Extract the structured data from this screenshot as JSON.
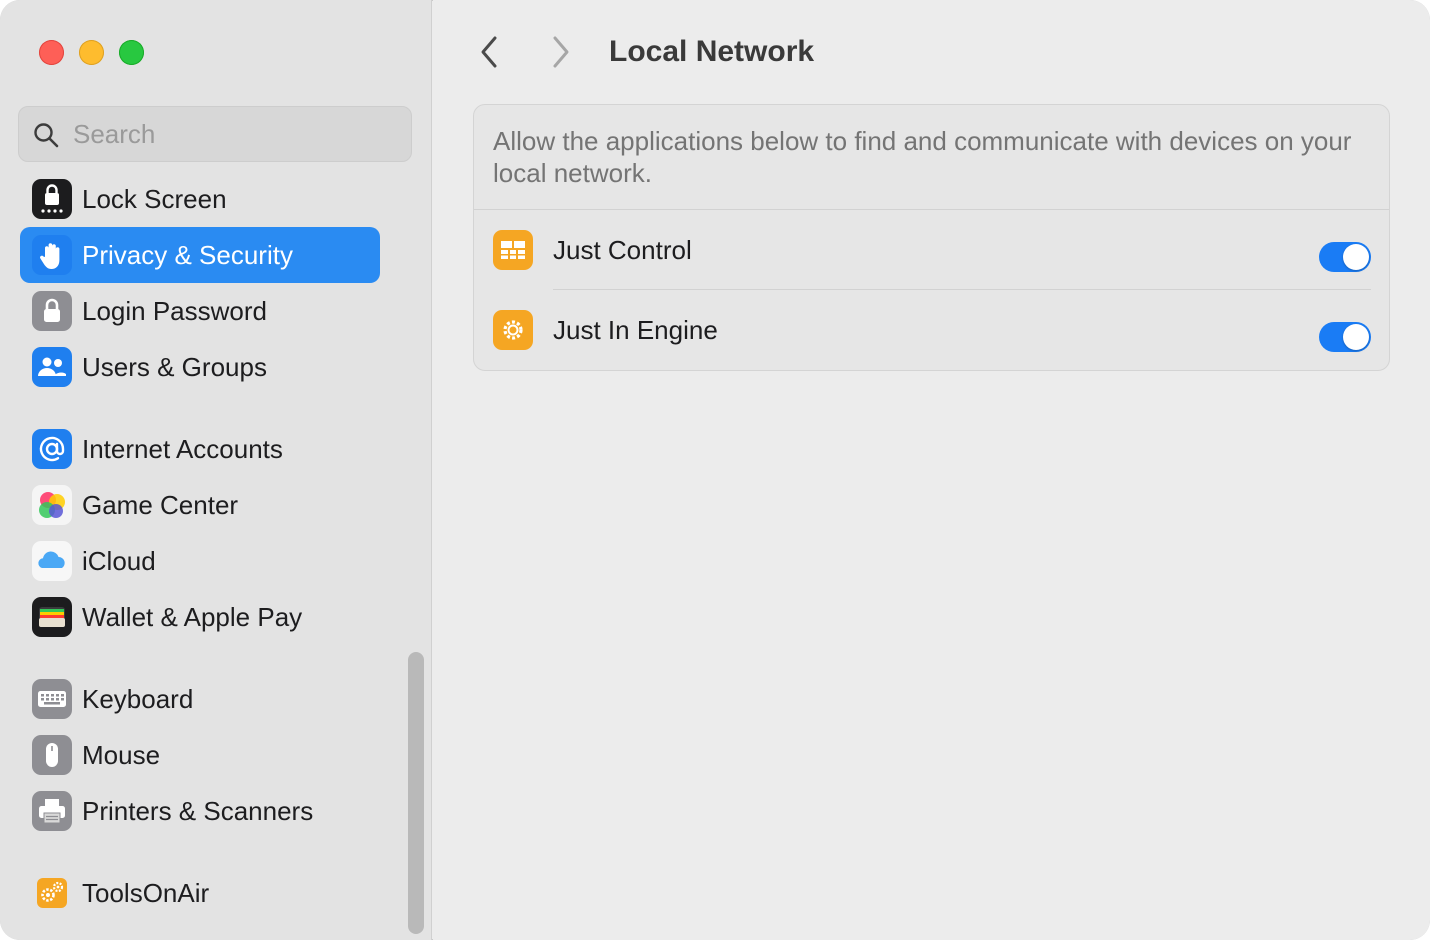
{
  "window": {
    "controls": [
      "close",
      "minimize",
      "zoom"
    ]
  },
  "search": {
    "placeholder": "Search",
    "value": ""
  },
  "sidebar": {
    "items": [
      {
        "label": "Lock Screen",
        "icon": "lock-screen-icon",
        "selected": false
      },
      {
        "label": "Privacy & Security",
        "icon": "hand-icon",
        "selected": true
      },
      {
        "label": "Login Password",
        "icon": "padlock-icon",
        "selected": false
      },
      {
        "label": "Users & Groups",
        "icon": "users-icon",
        "selected": false
      },
      {
        "label": "Internet Accounts",
        "icon": "at-sign-icon",
        "selected": false
      },
      {
        "label": "Game Center",
        "icon": "game-center-icon",
        "selected": false
      },
      {
        "label": "iCloud",
        "icon": "cloud-icon",
        "selected": false
      },
      {
        "label": "Wallet & Apple Pay",
        "icon": "wallet-icon",
        "selected": false
      },
      {
        "label": "Keyboard",
        "icon": "keyboard-icon",
        "selected": false
      },
      {
        "label": "Mouse",
        "icon": "mouse-icon",
        "selected": false
      },
      {
        "label": "Printers & Scanners",
        "icon": "printer-icon",
        "selected": false
      },
      {
        "label": "ToolsOnAir",
        "icon": "gears-icon",
        "selected": false
      }
    ]
  },
  "header": {
    "title": "Local Network"
  },
  "panel": {
    "description": "Allow the applications below to find and communicate with devices on your local network.",
    "apps": [
      {
        "name": "Just Control",
        "icon": "just-control-icon",
        "enabled": true
      },
      {
        "name": "Just In Engine",
        "icon": "just-in-engine-icon",
        "enabled": true
      }
    ]
  },
  "colors": {
    "accent": "#2a8bf2",
    "toggle_on": "#1a7cf5",
    "app_icon": "#f5a623"
  }
}
